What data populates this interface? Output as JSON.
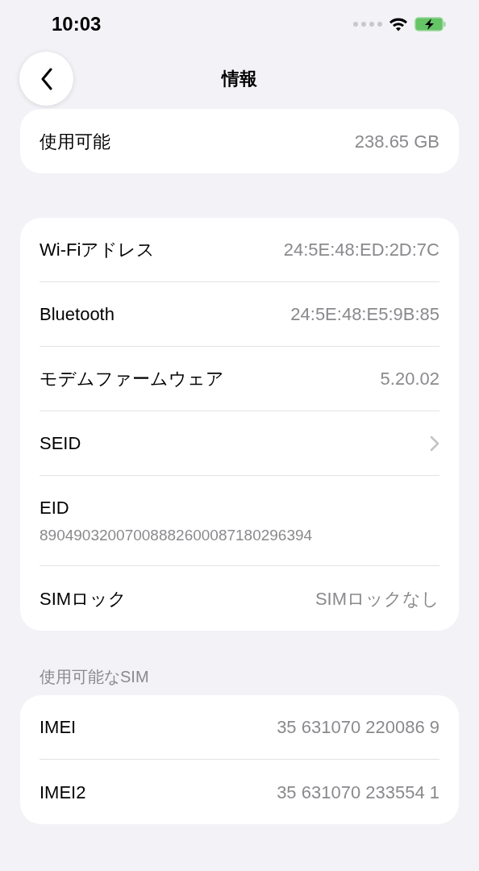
{
  "status_bar": {
    "time": "10:03"
  },
  "nav": {
    "title": "情報"
  },
  "sections": [
    {
      "rows": [
        {
          "kind": "value",
          "label": "使用可能",
          "value": "238.65 GB"
        }
      ]
    },
    {
      "rows": [
        {
          "kind": "value",
          "label": "Wi-Fiアドレス",
          "value": "24:5E:48:ED:2D:7C"
        },
        {
          "kind": "value",
          "label": "Bluetooth",
          "value": "24:5E:48:E5:9B:85"
        },
        {
          "kind": "value",
          "label": "モデムファームウェア",
          "value": "5.20.02"
        },
        {
          "kind": "link",
          "label": "SEID"
        },
        {
          "kind": "stacked",
          "label": "EID",
          "value": "89049032007008882600087180296394"
        },
        {
          "kind": "value",
          "label": "SIMロック",
          "value": "SIMロックなし"
        }
      ]
    },
    {
      "header": "使用可能なSIM",
      "rows": [
        {
          "kind": "value",
          "label": "IMEI",
          "value": "35 631070 220086 9"
        },
        {
          "kind": "value",
          "label": "IMEI2",
          "value": "35 631070 233554 1"
        }
      ]
    }
  ]
}
